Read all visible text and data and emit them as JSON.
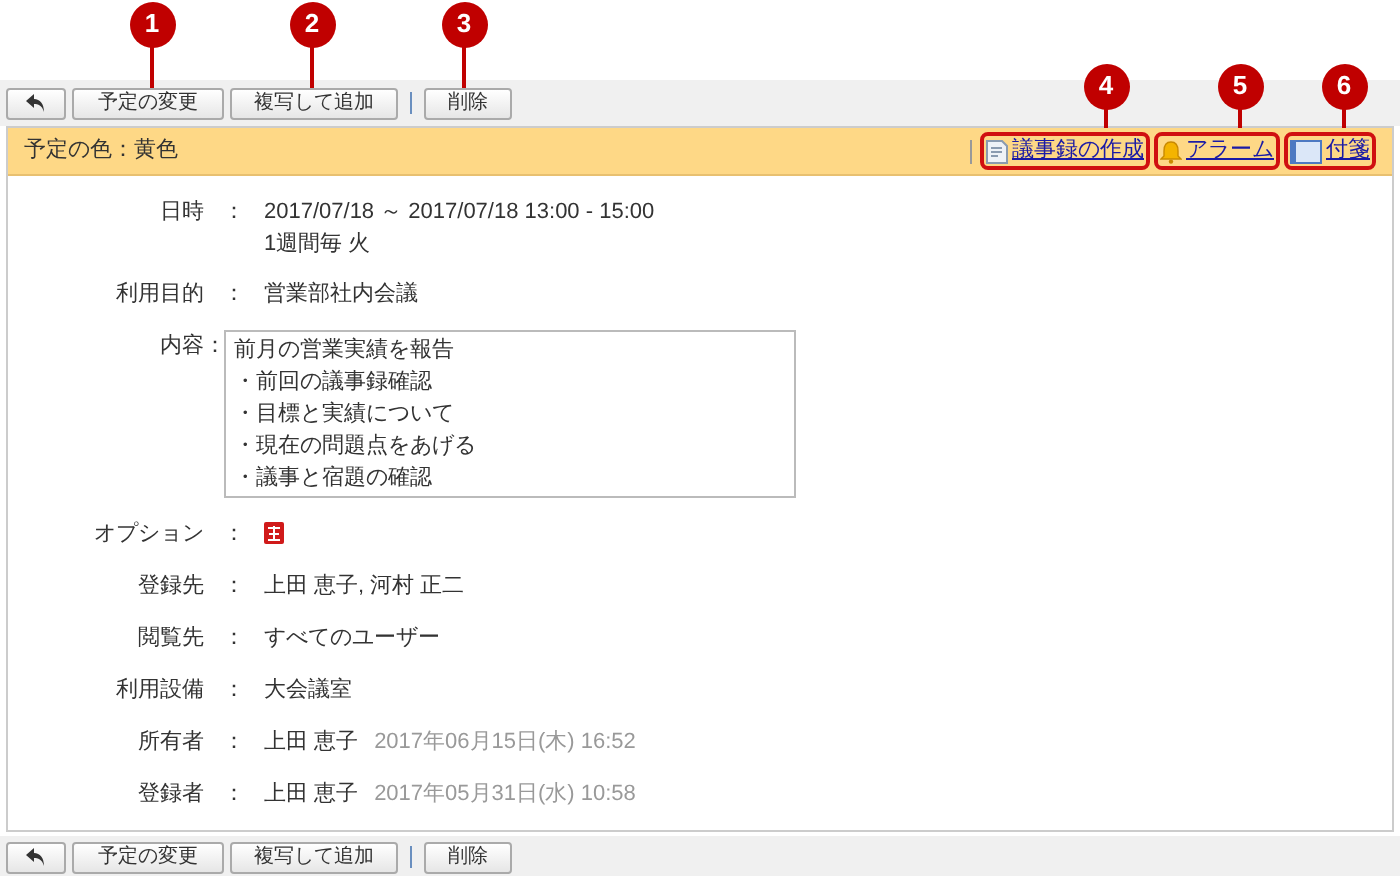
{
  "toolbar_top": {
    "buttons": [
      "予定の変更",
      "複写して追加",
      "削除"
    ]
  },
  "header": {
    "color_label": "予定の色：黄色",
    "links": [
      {
        "kind": "minutes",
        "label": "議事録の作成"
      },
      {
        "kind": "alarm",
        "label": "アラーム"
      },
      {
        "kind": "sticky",
        "label": "付箋"
      }
    ]
  },
  "fields": [
    {
      "kind": "text",
      "label": "日時",
      "separator": "：",
      "lines": [
        "2017/07/18 ～ 2017/07/18 13:00 - 15:00",
        "1週間毎 火"
      ]
    },
    {
      "kind": "text",
      "label": "利用目的",
      "separator": "：",
      "lines": [
        "営業部社内会議"
      ]
    },
    {
      "kind": "box",
      "label": "内容",
      "separator": "：",
      "lines": [
        "前月の営業実績を報告",
        "・前回の議事録確認",
        "・目標と実績について",
        "・現在の問題点をあげる",
        "・議事と宿題の確認"
      ]
    },
    {
      "kind": "icon",
      "label": "オプション",
      "separator": "："
    },
    {
      "kind": "text",
      "label": "登録先",
      "separator": "：",
      "lines": [
        "上田 恵子, 河村 正二"
      ]
    },
    {
      "kind": "text",
      "label": "閲覧先",
      "separator": "：",
      "lines": [
        "すべてのユーザー"
      ]
    },
    {
      "kind": "text",
      "label": "利用設備",
      "separator": "：",
      "lines": [
        "大会議室"
      ]
    },
    {
      "kind": "stamp",
      "label": "所有者",
      "separator": "：",
      "name": "上田 恵子",
      "time": "2017年06月15日(木) 16:52"
    },
    {
      "kind": "stamp",
      "label": "登録者",
      "separator": "：",
      "name": "上田 恵子",
      "time": "2017年05月31日(水) 10:58"
    }
  ],
  "toolbar_bottom": {
    "buttons": [
      "予定の変更",
      "複写して追加",
      "削除"
    ]
  },
  "callouts": [
    "1",
    "2",
    "3",
    "4",
    "5",
    "6"
  ]
}
